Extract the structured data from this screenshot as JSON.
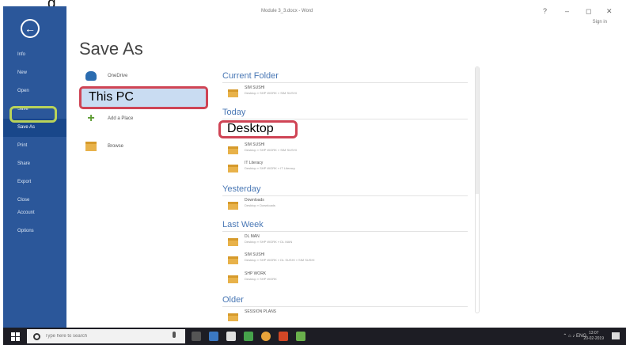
{
  "top_label": "g",
  "window": {
    "title": "Module 3_3.docx - Word",
    "help": "?",
    "minimize": "–",
    "maximize": "◻",
    "close": "✕",
    "signin": "Sign in"
  },
  "nav": {
    "back_icon": "back-arrow-icon",
    "items": [
      "Info",
      "New",
      "Open",
      "Save",
      "Save As",
      "Print",
      "Share",
      "Export",
      "Close"
    ],
    "bottom_items": [
      "Account",
      "Options"
    ]
  },
  "page_title": "Save As",
  "locations": {
    "onedrive": "OneDrive",
    "this_pc": "This PC",
    "add_place": "Add a Place",
    "browse": "Browse"
  },
  "recent": {
    "current_folder": {
      "title": "Current Folder",
      "items": [
        {
          "name": "SIM SUSHI",
          "path": "Desktop » SHP WORK » SIM SUSHI"
        }
      ]
    },
    "today": {
      "title": "Today",
      "items": [
        {
          "name": "Desktop",
          "path": ""
        },
        {
          "name": "SIM SUSHI",
          "path": "Desktop » SHP WORK » SIM SUSHI"
        },
        {
          "name": "IT Literacy",
          "path": "Desktop » SHP WORK » IT Literacy"
        }
      ]
    },
    "yesterday": {
      "title": "Yesterday",
      "items": [
        {
          "name": "Downloads",
          "path": "Desktop » Downloads"
        }
      ]
    },
    "last_week": {
      "title": "Last Week",
      "items": [
        {
          "name": "DL MAN",
          "path": "Desktop » SHP WORK » DL MAN"
        },
        {
          "name": "SIM SUSHI",
          "path": "Desktop » SHP WORK » DL SUSHI » SIM SUSHI"
        },
        {
          "name": "SHP WORK",
          "path": "Desktop » SHP WORK"
        }
      ]
    },
    "older": {
      "title": "Older",
      "items": [
        {
          "name": "SESSION PLANS",
          "path": ""
        }
      ]
    }
  },
  "taskbar": {
    "search_placeholder": "Type here to search",
    "tray_text": "⌃ ⌂ ♪ ENG",
    "time": "13:07",
    "date": "20-02-2019"
  },
  "colors": {
    "nav_blue": "#2b579a",
    "highlight_red": "#cf4455",
    "highlight_green": "#b9d35a",
    "section_blue": "#4a78b5",
    "folder_yellow": "#e8b24a"
  }
}
